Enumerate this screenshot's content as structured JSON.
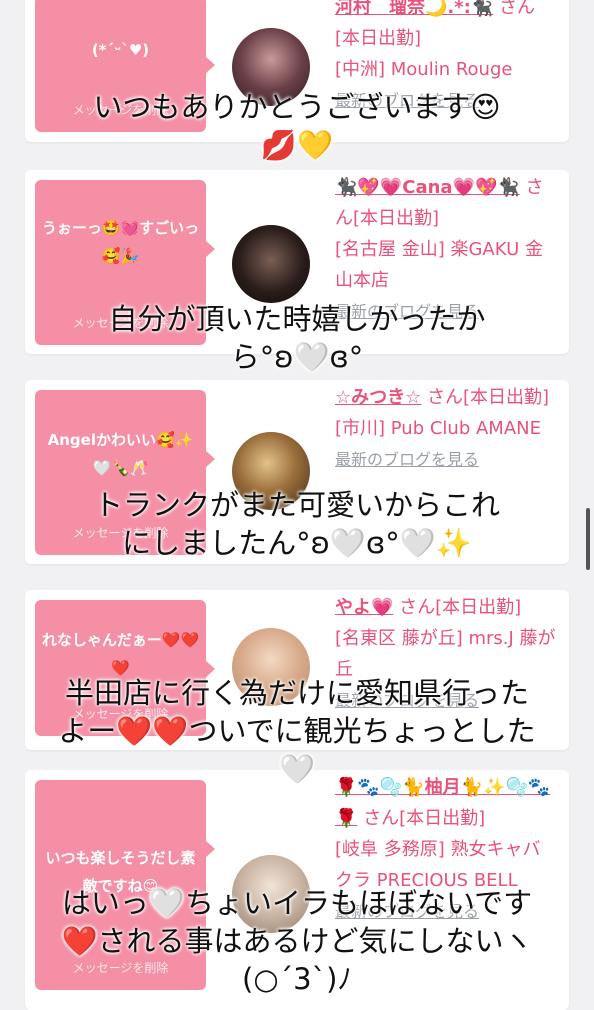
{
  "cards": [
    {
      "message": "(*ˊᵕˋ♥)",
      "delete_label": "メッセージを削除",
      "name": "河村　瑠奈🌙.*:🐈‍⬛",
      "title_suffix": "さん[本日出勤]",
      "area": "[中洲] Moulin Rouge",
      "blog": "最新のブログを見る"
    },
    {
      "message": "うぉーっ🤩💓すごいっ🥰🎉",
      "delete_label": "メッセージを削除",
      "name": "🐈‍⬛💖💗Cana💗💖🐈‍⬛",
      "title_suffix": "さん[本日出勤]",
      "area": "[名古屋 金山] 楽GAKU 金山本店",
      "blog": "最新のブログを見る"
    },
    {
      "message": "Angelかわいい🥰✨🤍🍾🥂",
      "delete_label": "メッセージを削除",
      "name": "☆みつき☆",
      "title_suffix": "さん[本日出勤]",
      "area": "[市川] Pub Club AMANE",
      "blog": "最新のブログを見る"
    },
    {
      "message": "れなしゃんだぁー❤️❤️❤️",
      "delete_label": "メッセージを削除",
      "name": "やよ💗",
      "title_suffix": "さん[本日出勤]",
      "area": "[名東区 藤が丘] mrs.J 藤が丘",
      "blog": "最新のブログを見る"
    },
    {
      "message": "いつも楽しそうだし素敵ですね😊",
      "delete_label": "メッセージを削除",
      "name": "🌹🐾🫧🐈柚月🐈✨🫧🐾🌹",
      "title_suffix": "さん[本日出勤]",
      "area": "[岐阜 多務原] 熟女キャバクラ PRECIOUS BELL",
      "blog": "最新のブログを見る"
    }
  ],
  "overlays": [
    {
      "line1": "いつもありかとうございます😍",
      "line2": "💋💛"
    },
    {
      "line1": "自分が頂いた時嬉しかったか",
      "line2": "ら°ʚ🤍ɞ°"
    },
    {
      "line1": "トランクがまた可愛いからこれ",
      "line2": "にしましたん°ʚ🤍ɞ°🤍✨"
    },
    {
      "line1": "半田店に行く為だけに愛知県行った",
      "line2": "よー❤️❤️ついでに観光ちょっとした",
      "line3": "🤍"
    },
    {
      "line1": "はいっ🤍ちょいイラもほぼないです",
      "line2": "❤️される事はあるけど気にしないヽ",
      "line3": "(○´3`)ﾉ"
    }
  ]
}
